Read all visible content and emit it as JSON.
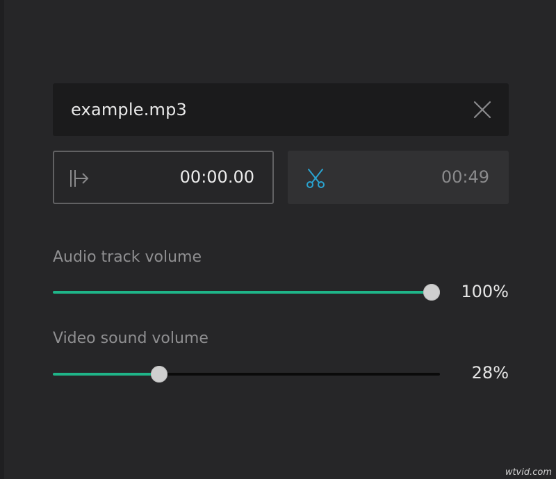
{
  "file": {
    "name": "example.mp3",
    "close_icon": "close-icon"
  },
  "trim": {
    "start_time": "00:00.00",
    "start_icon": "trim-start-icon",
    "end_time": "00:49",
    "end_icon": "scissors-icon"
  },
  "audio_volume": {
    "label": "Audio track volume",
    "value_text": "100%",
    "value": 1.0
  },
  "video_volume": {
    "label": "Video sound volume",
    "value_text": "28%",
    "value": 0.28
  },
  "watermark": "wtvid.com",
  "colors": {
    "accent": "#1fb589",
    "scissors": "#2aa3d0",
    "background": "#262628"
  }
}
